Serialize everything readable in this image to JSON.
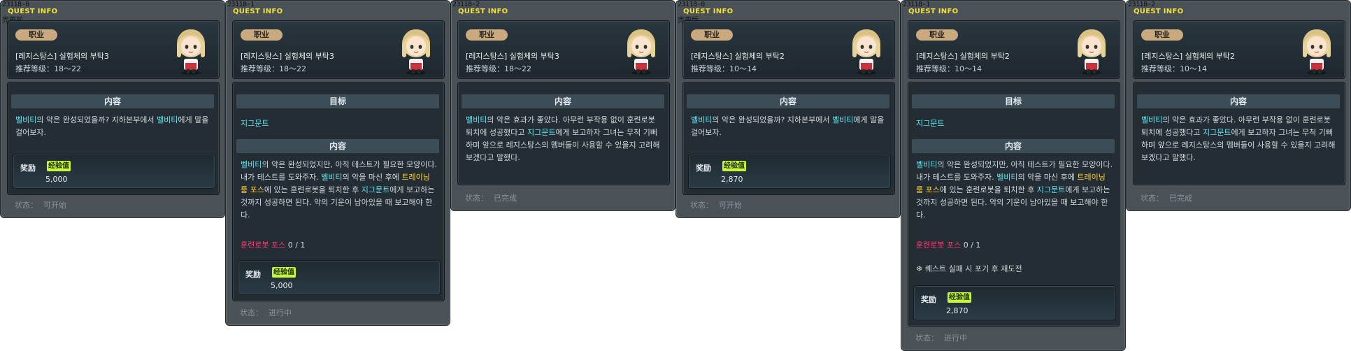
{
  "panels": [
    {
      "id": "23118-0",
      "title": "QUEST INFO",
      "note": "完更前",
      "job_label": "职业",
      "quest_name": "[레지스탕스] 실험체의 부탁3",
      "level_label": "推荐等级：",
      "level_range": "18～22",
      "content_header": "内容",
      "content_parts": [
        {
          "t": "벨비티",
          "c": "hl"
        },
        {
          "t": "의 악은 완성되었을까? 지하본부에서 ",
          "c": ""
        },
        {
          "t": "벨비티",
          "c": "hl"
        },
        {
          "t": "에게 말을 걸어보자.",
          "c": ""
        }
      ],
      "reward_label": "奖励",
      "exp_label": "经验值",
      "reward_value": "5,000",
      "status_label": "状态：",
      "status_value": "可开始"
    },
    {
      "id": "23118-1",
      "title": "QUEST INFO",
      "job_label": "职业",
      "quest_name": "[레지스탕스] 실험체의 부탁3",
      "level_label": "推荐等级：",
      "level_range": "18～22",
      "target_header": "目标",
      "target_name": "지그문트",
      "content_header": "内容",
      "content_parts": [
        {
          "t": "벨비티",
          "c": "hl"
        },
        {
          "t": "의 악은 완성되었지만, 아직 테스트가 필요한 모양이다. 내가 테스트를 도와주자. ",
          "c": ""
        },
        {
          "t": "벨비티",
          "c": "hl"
        },
        {
          "t": "의 악을 마신 후에 ",
          "c": ""
        },
        {
          "t": "트레이닝 룸 포스",
          "c": "hl-y"
        },
        {
          "t": "에 있는 훈련로봇을 퇴치한 후 ",
          "c": ""
        },
        {
          "t": "지그문트",
          "c": "hl"
        },
        {
          "t": "에게 보고하는 것까지 성공하면 된다. 악의 기운이 남아있을 때 보고해야 한다.",
          "c": ""
        }
      ],
      "req_name": "훈련로봇 포스",
      "req_count": "0 / 1",
      "reward_label": "奖励",
      "exp_label": "经验值",
      "reward_value": "5,000",
      "status_label": "状态：",
      "status_value": "进行中"
    },
    {
      "id": "23118-2",
      "title": "QUEST INFO",
      "job_label": "职业",
      "quest_name": "[레지스탕스] 실험체의 부탁3",
      "level_label": "推荐等级：",
      "level_range": "18～22",
      "content_header": "内容",
      "content_parts": [
        {
          "t": "벨비티",
          "c": "hl"
        },
        {
          "t": "의 악은 효과가 좋았다. 아무런 부작용 없이 훈련로봇 퇴치에 성공했다고 ",
          "c": ""
        },
        {
          "t": "지그문트",
          "c": "hl"
        },
        {
          "t": "에게 보고하자 그녀는 무척 기뻐하며 앞으로 레지스탕스의 멤버들이 사용할 수 있을지 고려해 보겠다고 말했다.",
          "c": ""
        }
      ],
      "status_label": "状态：",
      "status_value": "已完成"
    },
    {
      "id": "23118-0",
      "title": "QUEST INFO",
      "note": "完更后",
      "job_label": "职业",
      "quest_name": "[레지스탕스] 실험체의 부탁2",
      "level_label": "推荐等级：",
      "level_range": "10～14",
      "content_header": "内容",
      "content_parts": [
        {
          "t": "벨비티",
          "c": "hl"
        },
        {
          "t": "의 악은 완성되었을까? 지하본부에서 ",
          "c": ""
        },
        {
          "t": "벨비티",
          "c": "hl"
        },
        {
          "t": "에게 말을 걸어보자.",
          "c": ""
        }
      ],
      "reward_label": "奖励",
      "exp_label": "经验值",
      "reward_value": "2,870",
      "status_label": "状态：",
      "status_value": "可开始"
    },
    {
      "id": "23118-1",
      "title": "QUEST INFO",
      "job_label": "职业",
      "quest_name": "[레지스탕스] 실험체의 부탁2",
      "level_label": "推荐等级：",
      "level_range": "10～14",
      "target_header": "目标",
      "target_name": "지그문트",
      "content_header": "内容",
      "content_parts": [
        {
          "t": "벨비티",
          "c": "hl"
        },
        {
          "t": "의 악은 완성되었지만, 아직 테스트가 필요한 모양이다. 내가 테스트를 도와주자. ",
          "c": ""
        },
        {
          "t": "벨비티",
          "c": "hl"
        },
        {
          "t": "의 악을 마신 후에 ",
          "c": ""
        },
        {
          "t": "트레이닝 룸 포스",
          "c": "hl-y"
        },
        {
          "t": "에 있는 훈련로봇을 퇴치한 후 ",
          "c": ""
        },
        {
          "t": "지그문트",
          "c": "hl"
        },
        {
          "t": "에게 보고하는 것까지 성공하면 된다. 악의 기운이 남아있을 때 보고해야 한다.",
          "c": ""
        }
      ],
      "req_name": "훈련로봇 포스",
      "req_count": "0 / 1",
      "tip": "❄ 퀘스트 실패 시 포기 후 재도전",
      "reward_label": "奖励",
      "exp_label": "经验值",
      "reward_value": "2,870",
      "status_label": "状态：",
      "status_value": "进行中"
    },
    {
      "id": "23118-2",
      "title": "QUEST INFO",
      "job_label": "职业",
      "quest_name": "[레지스탕스] 실험체의 부탁2",
      "level_label": "推荐等级：",
      "level_range": "10～14",
      "content_header": "内容",
      "content_parts": [
        {
          "t": "벨비티",
          "c": "hl"
        },
        {
          "t": "의 악은 효과가 좋았다. 아무런 부작용 없이 훈련로봇 퇴치에 성공했다고 ",
          "c": ""
        },
        {
          "t": "지그문트",
          "c": "hl"
        },
        {
          "t": "에게 보고하자 그녀는 무척 기뻐하며 앞으로 레지스탕스의 멤버들이 사용할 수 있을지 고려해 보겠다고 말했다.",
          "c": ""
        }
      ],
      "status_label": "状态：",
      "status_value": "已完成"
    }
  ],
  "colors": {
    "panel_bg": "#4a5157",
    "title_yellow": "#f3e23a",
    "npc_highlight": "#63e3ef",
    "map_highlight": "#ffd33b",
    "mob_highlight": "#ff3b7a",
    "exp_badge": "#c6f83a"
  },
  "icons": {
    "npc_portrait": "npc-portrait-icon"
  }
}
